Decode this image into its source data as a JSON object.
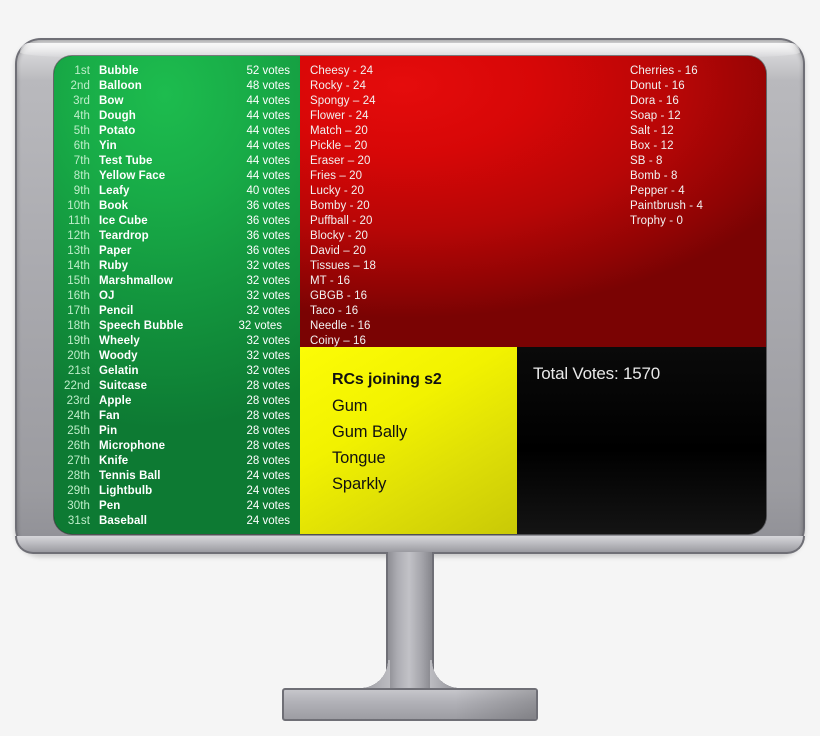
{
  "screen": {
    "green_panel": {
      "rows": [
        {
          "ordinal": "1st",
          "name": "Bubble",
          "votes": "52 votes"
        },
        {
          "ordinal": "2nd",
          "name": "Balloon",
          "votes": "48 votes"
        },
        {
          "ordinal": "3rd",
          "name": "Bow",
          "votes": "44 votes"
        },
        {
          "ordinal": "4th",
          "name": "Dough",
          "votes": "44 votes"
        },
        {
          "ordinal": "5th",
          "name": "Potato",
          "votes": "44 votes"
        },
        {
          "ordinal": "6th",
          "name": "Yin",
          "votes": "44 votes"
        },
        {
          "ordinal": "7th",
          "name": "Test Tube",
          "votes": "44 votes"
        },
        {
          "ordinal": "8th",
          "name": "Yellow Face",
          "votes": "44 votes"
        },
        {
          "ordinal": "9th",
          "name": "Leafy",
          "votes": "40 votes"
        },
        {
          "ordinal": "10th",
          "name": "Book",
          "votes": "36 votes"
        },
        {
          "ordinal": "11th",
          "name": "Ice Cube",
          "votes": "36 votes"
        },
        {
          "ordinal": "12th",
          "name": "Teardrop",
          "votes": "36 votes"
        },
        {
          "ordinal": "13th",
          "name": "Paper",
          "votes": "36 votes"
        },
        {
          "ordinal": "14th",
          "name": "Ruby",
          "votes": "32 votes"
        },
        {
          "ordinal": "15th",
          "name": "Marshmallow",
          "votes": "32 votes"
        },
        {
          "ordinal": "16th",
          "name": "OJ",
          "votes": "32 votes"
        },
        {
          "ordinal": "17th",
          "name": "Pencil",
          "votes": "32 votes"
        },
        {
          "ordinal": "18th",
          "name": "Speech  Bubble",
          "votes": "32 votes"
        },
        {
          "ordinal": "19th",
          "name": "Wheely",
          "votes": "32 votes"
        },
        {
          "ordinal": "20th",
          "name": "Woody",
          "votes": "32 votes"
        },
        {
          "ordinal": "21st",
          "name": "Gelatin",
          "votes": "32 votes"
        },
        {
          "ordinal": "22nd",
          "name": "Suitcase",
          "votes": "28 votes"
        },
        {
          "ordinal": "23rd",
          "name": "Apple",
          "votes": "28 votes"
        },
        {
          "ordinal": "24th",
          "name": "Fan",
          "votes": "28 votes"
        },
        {
          "ordinal": "25th",
          "name": "Pin",
          "votes": "28 votes"
        },
        {
          "ordinal": "26th",
          "name": "Microphone",
          "votes": "28 votes"
        },
        {
          "ordinal": "27th",
          "name": "Knife",
          "votes": "28 votes"
        },
        {
          "ordinal": "28th",
          "name": "Tennis Ball",
          "votes": "24 votes"
        },
        {
          "ordinal": "29th",
          "name": "Lightbulb",
          "votes": "24 votes"
        },
        {
          "ordinal": "30th",
          "name": "Pen",
          "votes": "24 votes"
        },
        {
          "ordinal": "31st",
          "name": "Baseball",
          "votes": "24 votes"
        }
      ]
    },
    "red_panel": {
      "column_left": [
        "Cheesy  - 24",
        "Rocky - 24",
        "Spongy – 24",
        "Flower - 24",
        "Match – 20",
        "Pickle – 20",
        "Eraser – 20",
        "Fries – 20",
        "Lucky - 20",
        "Bomby - 20",
        "Puffball - 20",
        "Blocky - 20",
        "David – 20",
        "Tissues – 18",
        "MT - 16",
        "GBGB - 16",
        "Taco - 16",
        "Needle - 16",
        "Coiny – 16"
      ],
      "column_right": [
        "Cherries - 16",
        "Donut - 16",
        "Dora - 16",
        "Soap - 12",
        "Salt - 12",
        "Box - 12",
        "SB - 8",
        "Bomb - 8",
        "Pepper - 4",
        "Paintbrush  - 4",
        "Trophy - 0"
      ]
    },
    "yellow_panel": {
      "heading": "RCs joining s2",
      "items": [
        "Gum",
        "Gum Bally",
        "Tongue",
        "Sparkly"
      ]
    },
    "black_panel": {
      "total_votes_label": "Total Votes: 1570"
    }
  },
  "colors": {
    "green": "#18ab47",
    "red": "#d70707",
    "yellow": "#f2f200",
    "black": "#000000",
    "bezel_gray": "#a9a9ae",
    "bezel_outline": "#6f6f76"
  }
}
